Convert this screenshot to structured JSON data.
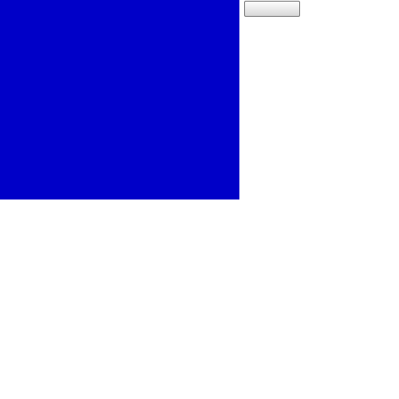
{
  "colors": {
    "background": "#ffffff",
    "panel_fill": "#0000c8"
  },
  "button": {
    "label": ""
  }
}
